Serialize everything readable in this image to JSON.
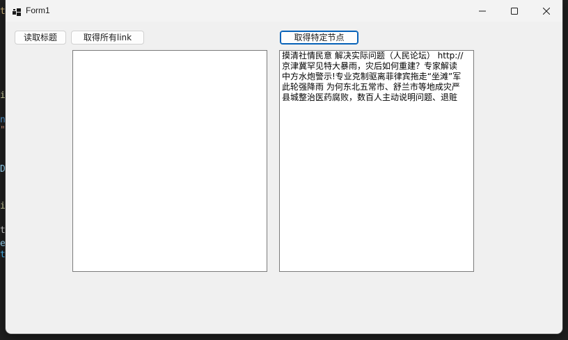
{
  "window": {
    "title": "Form1",
    "icon": "app-window-icon",
    "controls": {
      "minimize_icon": "minimize-icon",
      "maximize_icon": "maximize-icon",
      "close_icon": "close-icon"
    }
  },
  "buttons": {
    "read_title": "读取标题",
    "get_all_links": "取得所有link",
    "get_specific_node": "取得特定节点"
  },
  "left_list": {
    "items": []
  },
  "right_list": {
    "items": [
      "摸清社情民意 解决实际问题（人民论坛） http://",
      "京津冀罕见特大暴雨，灾后如何重建？专家解读",
      "中方水炮警示!专业克制驱离菲律宾拖走“坐滩”军",
      "此轮强降雨 为何东北五常市、舒兰市等地成灾严",
      "县城整治医药腐败，数百人主动说明问题、退赃"
    ]
  },
  "background_editor": {
    "glyphs": [
      "t",
      "i",
      "n",
      "\"",
      "D",
      "i",
      "t",
      "e",
      "t"
    ],
    "colors": [
      "#d7ba7d",
      "#dcdcaa",
      "#569cd6",
      "#ce9178",
      "#9cdcfe",
      "#dcdcaa",
      "#d4d4d4",
      "#9cdcfe",
      "#4fc1ff"
    ]
  }
}
